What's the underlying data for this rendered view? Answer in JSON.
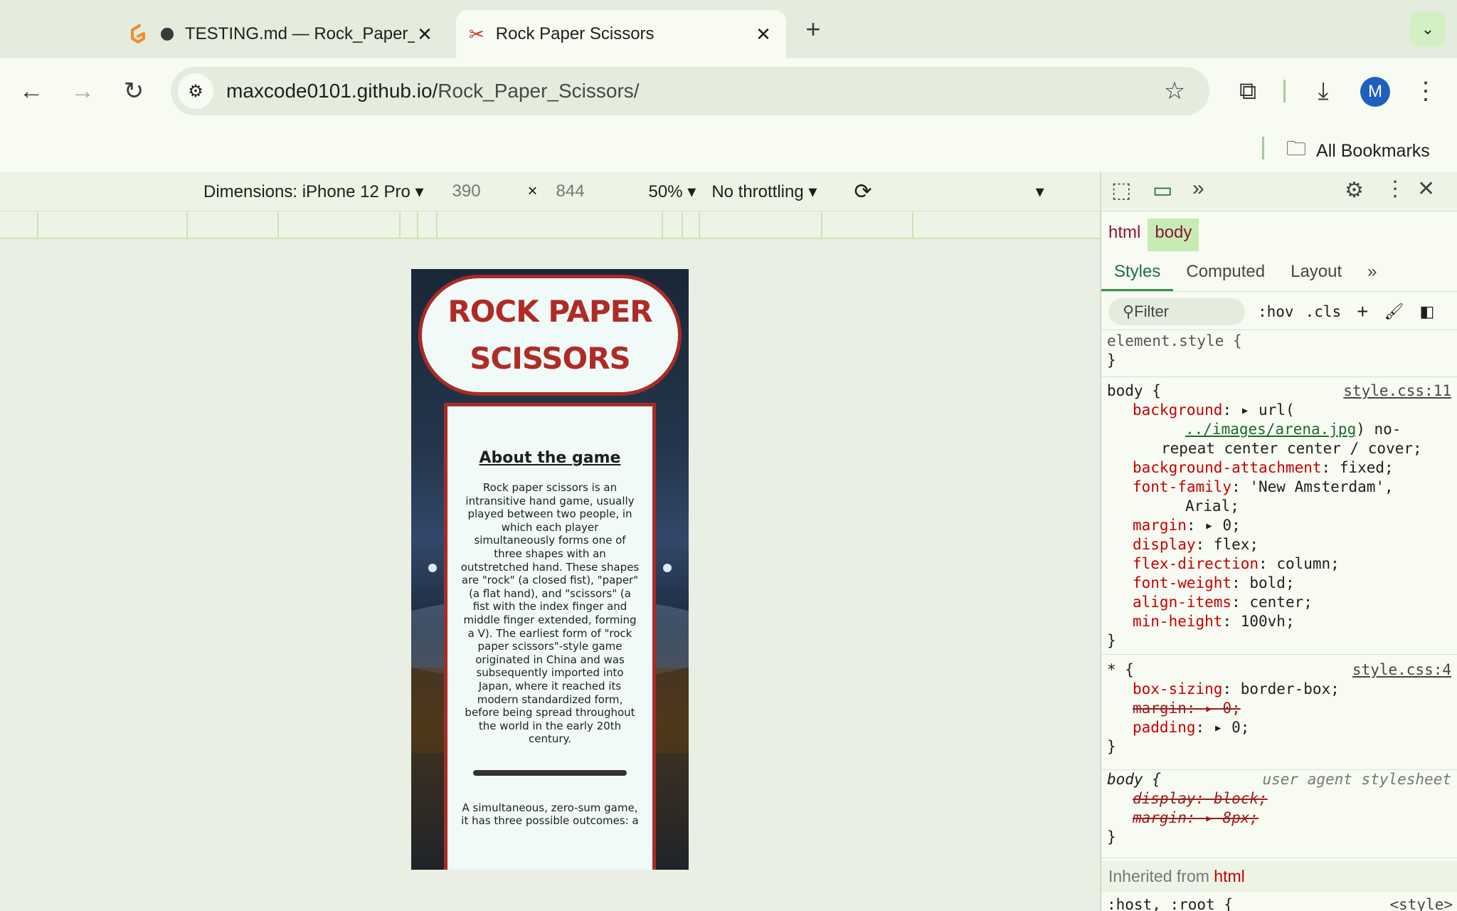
{
  "tabs": [
    {
      "title": "TESTING.md — Rock_Paper_Scissors",
      "icon": "gitpod-icon"
    },
    {
      "title": "Rock Paper Scissors",
      "icon": "scissors-icon"
    }
  ],
  "omnibox": {
    "host": "maxcode0101.github.io/",
    "path": "Rock_Paper_Scissors/"
  },
  "profile_initial": "M",
  "bookmarks_label": "All Bookmarks",
  "devicebar": {
    "dimensions": "Dimensions: iPhone 12 Pro",
    "width": "390",
    "times": "×",
    "height": "844",
    "zoom": "50%",
    "throttling": "No throttling"
  },
  "page": {
    "title_line1": "ROCK PAPER",
    "title_line2": "SCISSORS",
    "about_heading": "About the game",
    "about_text": "Rock paper scissors is an intransitive hand game, usually played between two people, in which each player simultaneously forms one of three shapes with an outstretched hand. These shapes are \"rock\" (a closed fist), \"paper\" (a flat hand), and \"scissors\" (a fist with the index finger and middle finger extended, forming a V). The earliest form of \"rock paper scissors\"-style game originated in China and was subsequently imported into Japan, where it reached its modern standardized form, before being spread throughout the world in the early 20th century.",
    "about_text2": "A simultaneous, zero-sum game, it has three possible outcomes: a"
  },
  "devtools": {
    "crumbs": [
      "html",
      "body"
    ],
    "subtabs": [
      "Styles",
      "Computed",
      "Layout"
    ],
    "filter_placeholder": "Filter",
    "hov": ":hov",
    "cls": ".cls",
    "element_style": "element.style {",
    "close_brace": "}",
    "rule1": {
      "selector": "body {",
      "source": "style.css:11",
      "background_name": "background",
      "background_pre": "url(",
      "background_url": "../images/arena.jpg",
      "background_post1": ") no-",
      "background_post2": "repeat center center / cover;",
      "props": [
        {
          "n": "background-attachment",
          "v": "fixed;"
        },
        {
          "n": "font-family",
          "v": "'New Amsterdam',"
        },
        {
          "n": "",
          "v": "Arial;"
        },
        {
          "n": "margin",
          "v": "▸ 0;"
        },
        {
          "n": "display",
          "v": "flex;"
        },
        {
          "n": "flex-direction",
          "v": "column;"
        },
        {
          "n": "font-weight",
          "v": "bold;"
        },
        {
          "n": "align-items",
          "v": "center;"
        },
        {
          "n": "min-height",
          "v": "100vh;"
        }
      ]
    },
    "rule2": {
      "selector": "* {",
      "source": "style.css:4",
      "props": [
        {
          "n": "box-sizing",
          "v": "border-box;"
        },
        {
          "n": "margin",
          "v": "▸ 0;",
          "struck": true
        },
        {
          "n": "padding",
          "v": "▸ 0;"
        }
      ]
    },
    "rule3": {
      "selector": "body {",
      "source": "user agent stylesheet",
      "props": [
        {
          "n": "display",
          "v": "block;"
        },
        {
          "n": "margin",
          "v": "▸ 8px;"
        }
      ]
    },
    "inherited": "Inherited from",
    "inherited_el": "html",
    "root_selector": ":host, :root {",
    "root_source": "<style>"
  }
}
